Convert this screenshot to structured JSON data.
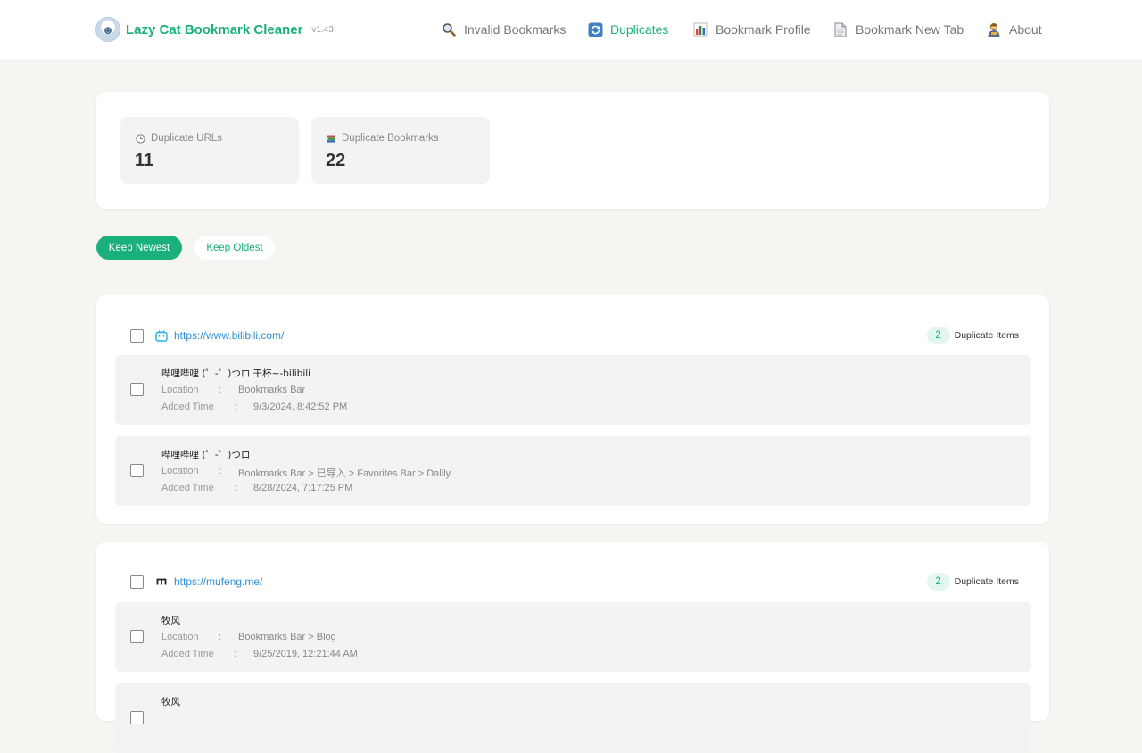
{
  "app": {
    "name": "Lazy Cat Bookmark Cleaner",
    "version": "v1.43",
    "accent": "#19b07b"
  },
  "nav": [
    {
      "label": "Invalid Bookmarks",
      "icon": "magnifier-icon",
      "active": false
    },
    {
      "label": "Duplicates",
      "icon": "refresh-icon",
      "active": true
    },
    {
      "label": "Bookmark Profile",
      "icon": "bar-chart-icon",
      "active": false
    },
    {
      "label": "Bookmark New Tab",
      "icon": "page-icon",
      "active": false
    },
    {
      "label": "About",
      "icon": "person-icon",
      "active": false
    }
  ],
  "stats": [
    {
      "label": "Duplicate URLs",
      "value": "11",
      "icon": "clock-icon"
    },
    {
      "label": "Duplicate Bookmarks",
      "value": "22",
      "icon": "books-icon"
    }
  ],
  "actions": {
    "keep_newest": "Keep Newest",
    "keep_oldest": "Keep Oldest"
  },
  "labels": {
    "location": "Location",
    "added_time": "Added Time",
    "colon": ":",
    "duplicate_items": "Duplicate Items"
  },
  "groups": [
    {
      "url": "https://www.bilibili.com/",
      "favicon": "bilibili-tv-icon",
      "count": "2",
      "items": [
        {
          "title": "哔哩哔哩 (゜-゜)つロ 干杯~-bilibili",
          "location": "Bookmarks Bar",
          "added": "9/3/2024, 8:42:52 PM"
        },
        {
          "title": "哔哩哔哩 (゜-゜)つロ",
          "location": "Bookmarks Bar > 已导入 > Favorites Bar > Dalily",
          "added": "8/28/2024, 7:17:25 PM"
        }
      ]
    },
    {
      "url": "https://mufeng.me/",
      "favicon": "mufeng-m-icon",
      "count": "2",
      "items": [
        {
          "title": "牧风",
          "location": "Bookmarks Bar > Blog",
          "added": "9/25/2019, 12:21:44 AM"
        },
        {
          "title": "牧风",
          "location": "",
          "added": ""
        }
      ]
    }
  ]
}
